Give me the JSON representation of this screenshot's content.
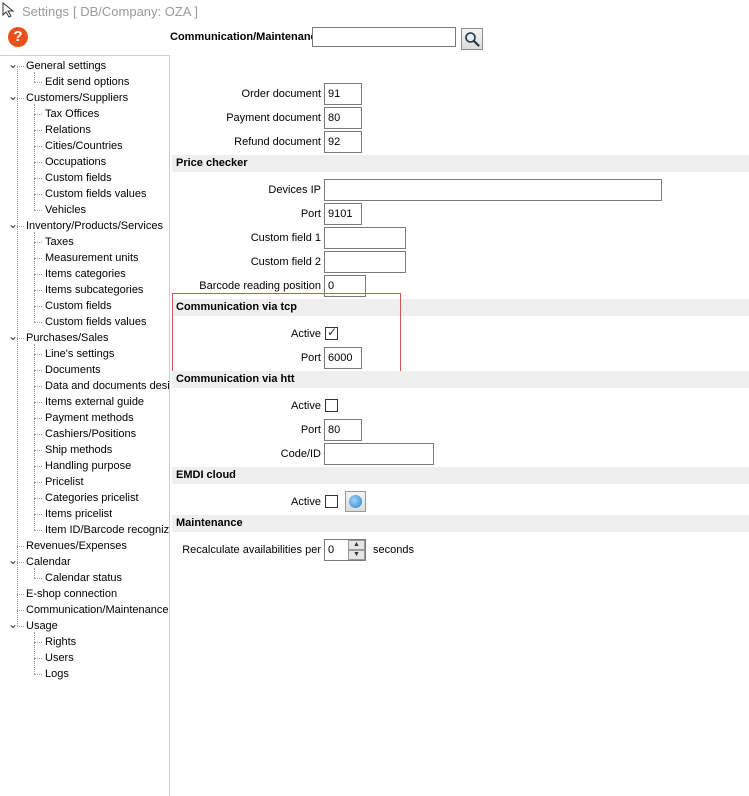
{
  "window": {
    "title": "Settings",
    "company": "[ DB/Company: OZA ]"
  },
  "toolbar": {
    "section_title": "Communication/Maintenance",
    "search_value": "",
    "search_icon": "magnifier-icon",
    "help_icon": "?"
  },
  "sidebar": {
    "items": [
      {
        "label": "General settings",
        "level": 0,
        "expanded": true
      },
      {
        "label": "Edit send options",
        "level": 1
      },
      {
        "label": "Customers/Suppliers",
        "level": 0,
        "expanded": true
      },
      {
        "label": "Tax Offices",
        "level": 1
      },
      {
        "label": "Relations",
        "level": 1
      },
      {
        "label": "Cities/Countries",
        "level": 1
      },
      {
        "label": "Occupations",
        "level": 1
      },
      {
        "label": "Custom fields",
        "level": 1
      },
      {
        "label": "Custom fields values",
        "level": 1
      },
      {
        "label": "Vehicles",
        "level": 1
      },
      {
        "label": "Inventory/Products/Services",
        "level": 0,
        "expanded": true
      },
      {
        "label": "Taxes",
        "level": 1
      },
      {
        "label": "Measurement units",
        "level": 1
      },
      {
        "label": "Items categories",
        "level": 1
      },
      {
        "label": "Items subcategories",
        "level": 1
      },
      {
        "label": "Custom fields",
        "level": 1
      },
      {
        "label": "Custom fields values",
        "level": 1
      },
      {
        "label": "Purchases/Sales",
        "level": 0,
        "expanded": true
      },
      {
        "label": "Line's settings",
        "level": 1
      },
      {
        "label": "Documents",
        "level": 1
      },
      {
        "label": "Data and documents design",
        "level": 1
      },
      {
        "label": "Items external guide",
        "level": 1
      },
      {
        "label": "Payment methods",
        "level": 1
      },
      {
        "label": "Cashiers/Positions",
        "level": 1
      },
      {
        "label": "Ship methods",
        "level": 1
      },
      {
        "label": "Handling purpose",
        "level": 1
      },
      {
        "label": "Pricelist",
        "level": 1
      },
      {
        "label": "Categories pricelist",
        "level": 1
      },
      {
        "label": "Items pricelist",
        "level": 1
      },
      {
        "label": "Item ID/Barcode recognizer",
        "level": 1
      },
      {
        "label": "Revenues/Expenses",
        "level": 0
      },
      {
        "label": "Calendar",
        "level": 0,
        "expanded": true
      },
      {
        "label": "Calendar status",
        "level": 1
      },
      {
        "label": "E-shop connection",
        "level": 0
      },
      {
        "label": "Communication/Maintenance",
        "level": 0
      },
      {
        "label": "Usage",
        "level": 0,
        "expanded": true
      },
      {
        "label": "Rights",
        "level": 1
      },
      {
        "label": "Users",
        "level": 1
      },
      {
        "label": "Logs",
        "level": 1
      }
    ]
  },
  "form": {
    "documents": {
      "order_label": "Order document",
      "order_value": "91",
      "payment_label": "Payment document",
      "payment_value": "80",
      "refund_label": "Refund document",
      "refund_value": "92"
    },
    "price_checker": {
      "header": "Price checker",
      "devices_ip_label": "Devices IP",
      "devices_ip_value": "",
      "port_label": "Port",
      "port_value": "9101",
      "custom1_label": "Custom field 1",
      "custom1_value": "",
      "custom2_label": "Custom field 2",
      "custom2_value": "",
      "barcode_label": "Barcode reading position",
      "barcode_value": "0"
    },
    "tcp": {
      "header": "Communication via tcp",
      "active_label": "Active",
      "active_checked": true,
      "port_label": "Port",
      "port_value": "6000"
    },
    "http": {
      "header": "Communication via htt",
      "active_label": "Active",
      "active_checked": false,
      "port_label": "Port",
      "port_value": "80",
      "code_label": "Code/ID",
      "code_value": ""
    },
    "emdi": {
      "header": "EMDI cloud",
      "active_label": "Active",
      "active_checked": false,
      "globe_icon": "globe-icon"
    },
    "maintenance": {
      "header": "Maintenance",
      "recalc_label": "Recalculate availabilities per",
      "recalc_value": "0",
      "recalc_unit": "seconds"
    }
  },
  "colors": {
    "highlight_border": "#d9534f",
    "section_bg": "#efefef",
    "help_icon_bg": "#e8511c"
  }
}
